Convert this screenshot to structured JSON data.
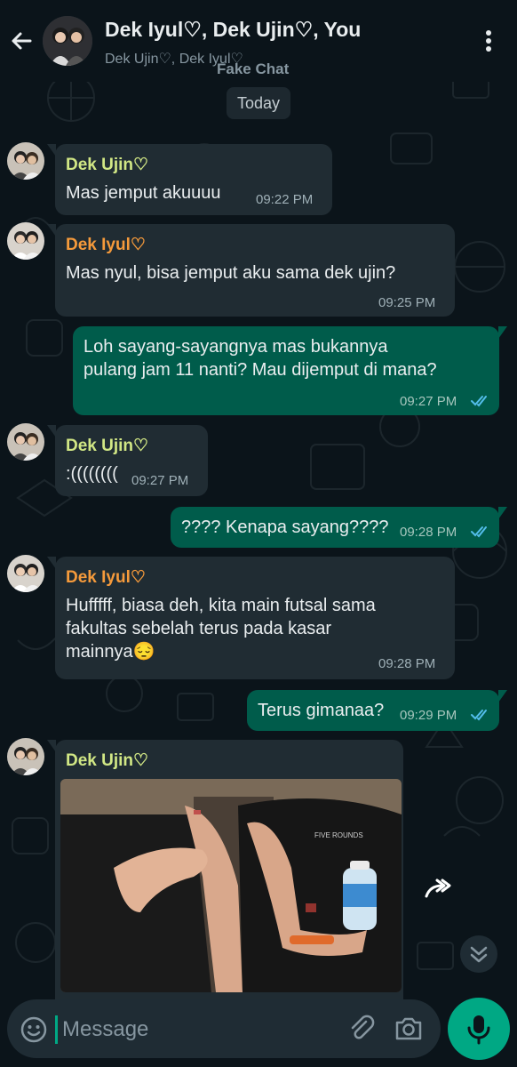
{
  "header": {
    "title": "Dek Iyul♡, Dek Ujin♡, You",
    "subtitle": "Dek Ujin♡, Dek Iyul♡",
    "watermark": "Fake Chat",
    "icons": [
      "back-arrow-icon",
      "group-avatar",
      "menu-dots-icon"
    ]
  },
  "date_chip": "Today",
  "colors": {
    "background": "#0b141a",
    "incoming_bubble": "#202c33",
    "outgoing_bubble": "#005c4b",
    "accent": "#00a884",
    "read_ticks": "#53bdeb",
    "sender_ujin": "#d1e785",
    "sender_iyul": "#f59a3b"
  },
  "messages": [
    {
      "direction": "in",
      "sender": "Dek Ujin♡",
      "text": "Mas jemput akuuuu",
      "time": "09:22 PM"
    },
    {
      "direction": "in",
      "sender": "Dek Iyul♡",
      "text": "Mas nyul, bisa jemput aku sama dek ujin?",
      "time": "09:25 PM"
    },
    {
      "direction": "out",
      "text": "Loh sayang-sayangnya mas bukannya\npulang jam 11 nanti? Mau dijemput di mana?",
      "time": "09:27 PM",
      "status": "read"
    },
    {
      "direction": "in",
      "sender": "Dek Ujin♡",
      "text": ":((((((((",
      "time": "09:27 PM"
    },
    {
      "direction": "out",
      "text": "???? Kenapa sayang????",
      "time": "09:28 PM",
      "status": "read"
    },
    {
      "direction": "in",
      "sender": "Dek Iyul♡",
      "text": "Hufffff, biasa deh, kita main futsal sama\nfakultas sebelah terus pada kasar\nmainnya😔",
      "time": "09:28 PM"
    },
    {
      "direction": "out",
      "text": "Terus gimanaa?",
      "time": "09:29 PM",
      "status": "read"
    },
    {
      "direction": "in",
      "sender": "Dek Ujin♡",
      "type": "photo",
      "photo_text": "FIVE ROUNDS"
    }
  ],
  "composer": {
    "placeholder": "Message",
    "icons": [
      "emoji-icon",
      "attach-icon",
      "camera-icon",
      "mic-icon"
    ]
  },
  "floating": {
    "icons": [
      "forward-icon",
      "scroll-down-icon"
    ]
  }
}
